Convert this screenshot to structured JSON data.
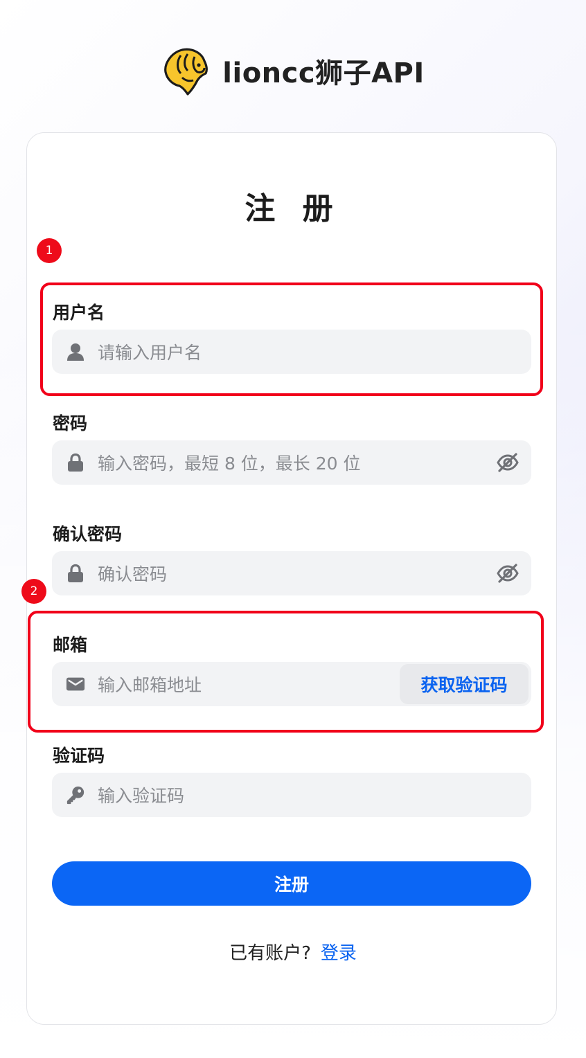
{
  "brand": {
    "name": "lioncc狮子API"
  },
  "form": {
    "title": "注 册",
    "username": {
      "label": "用户名",
      "placeholder": "请输入用户名"
    },
    "password": {
      "label": "密码",
      "placeholder": "输入密码，最短 8 位，最长 20 位"
    },
    "confirm_password": {
      "label": "确认密码",
      "placeholder": "确认密码"
    },
    "email": {
      "label": "邮箱",
      "placeholder": "输入邮箱地址",
      "send_code_label": "获取验证码"
    },
    "code": {
      "label": "验证码",
      "placeholder": "输入验证码"
    },
    "submit_label": "注册",
    "footer": {
      "prompt": "已有账户?",
      "login_link": "登录"
    }
  },
  "annotations": [
    {
      "number": "1"
    },
    {
      "number": "2"
    }
  ],
  "colors": {
    "accent": "#0b66f5",
    "annotation": "#f1001a",
    "logo_yellow": "#f7c52c"
  },
  "icons": [
    "lion-logo-icon",
    "user-icon",
    "lock-icon",
    "eye-off-icon",
    "mail-icon",
    "key-icon"
  ]
}
